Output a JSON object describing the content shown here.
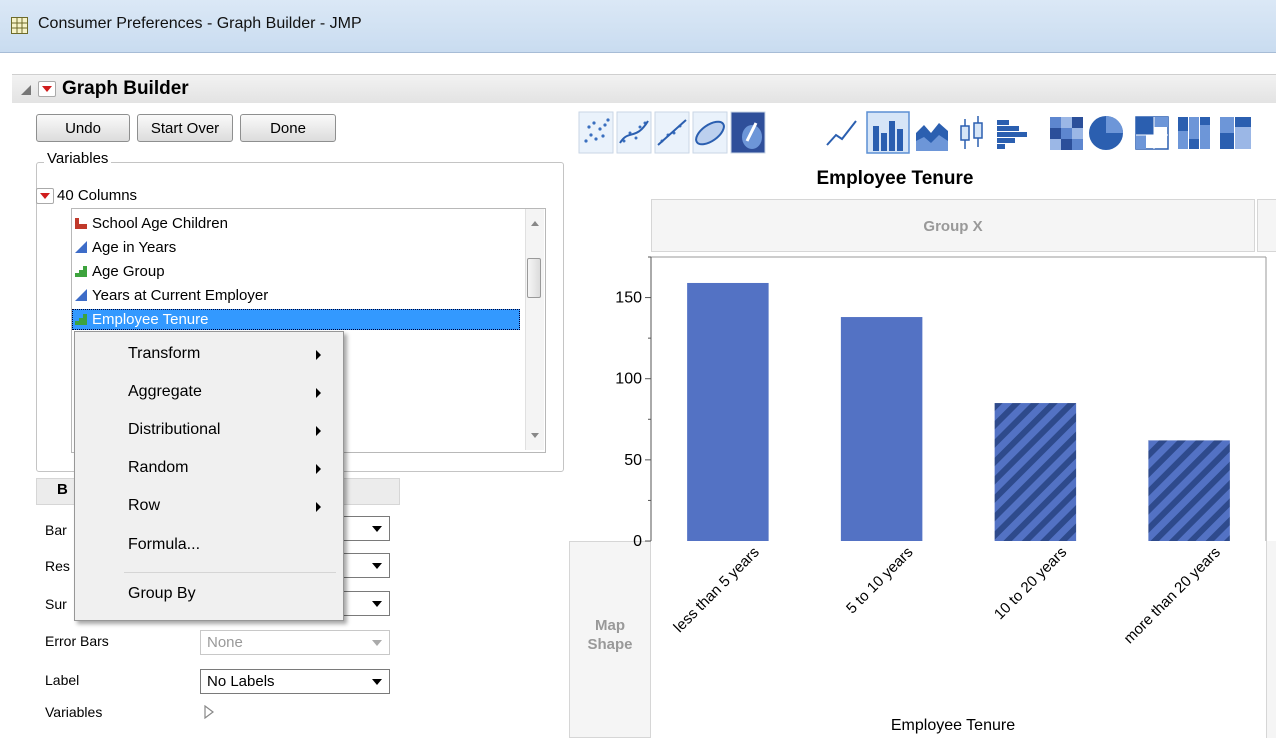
{
  "window": {
    "title": "Consumer Preferences - Graph Builder - JMP"
  },
  "graph_builder": {
    "title": "Graph Builder",
    "buttons": {
      "undo": "Undo",
      "start_over": "Start Over",
      "done": "Done"
    }
  },
  "variables": {
    "legend": "Variables",
    "columns_label": "40 Columns",
    "items": [
      {
        "label": "School Age Children",
        "icon": "nominal-icon",
        "color": "#c0392b"
      },
      {
        "label": "Age in Years",
        "icon": "continuous-icon",
        "color": "#3d6cc8"
      },
      {
        "label": "Age Group",
        "icon": "ordinal-icon",
        "color": "#3da33d"
      },
      {
        "label": "Years at Current Employer",
        "icon": "continuous-icon",
        "color": "#3d6cc8"
      },
      {
        "label": "Employee Tenure",
        "icon": "ordinal-icon",
        "color": "#3da33d",
        "selected": true
      }
    ]
  },
  "context_menu": {
    "items": [
      {
        "label": "Transform",
        "submenu": true
      },
      {
        "label": "Aggregate",
        "submenu": true
      },
      {
        "label": "Distributional",
        "submenu": true
      },
      {
        "label": "Random",
        "submenu": true
      },
      {
        "label": "Row",
        "submenu": true
      },
      {
        "label": "Formula...",
        "submenu": false
      },
      {
        "label": "Group By",
        "submenu": false
      }
    ]
  },
  "bar_panel": {
    "header_fragment": "B",
    "label_fragments": [
      "Bar",
      "Res",
      "Sur"
    ],
    "error_bars_label": "Error Bars",
    "error_bars_value": "None",
    "label_label": "Label",
    "label_value": "No Labels",
    "variables_label": "Variables"
  },
  "toolbar": {
    "icons": [
      "points-icon",
      "smoother-icon",
      "line-of-fit-icon",
      "ellipse-icon",
      "contour-icon",
      "line-icon",
      "bar-icon",
      "area-icon",
      "box-plot-icon",
      "histogram-icon",
      "heatmap-icon",
      "pie-icon",
      "treemap-icon",
      "mosaic-icon"
    ],
    "selected": "bar-icon"
  },
  "chart": {
    "group_x_label": "Group X",
    "map_shape_label_1": "Map",
    "map_shape_label_2": "Shape"
  },
  "chart_data": {
    "type": "bar",
    "title": "Employee Tenure",
    "xlabel": "Employee Tenure",
    "ylabel": "",
    "categories": [
      "less than 5 years",
      "5 to 10 years",
      "10 to 20 years",
      "more than 20 years"
    ],
    "values": [
      159,
      138,
      85,
      62
    ],
    "patterns": [
      "solid",
      "solid",
      "hatched",
      "hatched"
    ],
    "ylim": [
      0,
      175
    ],
    "yticks": [
      0,
      50,
      100,
      150
    ],
    "bar_color": "#5372c4",
    "hatch_color": "#2e4a8c"
  }
}
